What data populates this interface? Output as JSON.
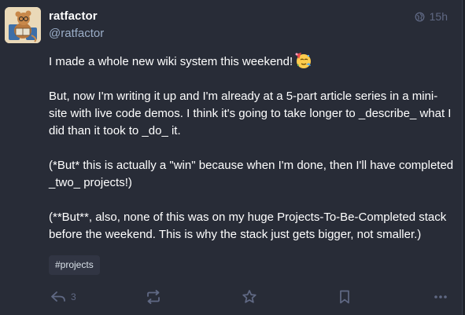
{
  "post": {
    "display_name": "ratfactor",
    "handle": "@ratfactor",
    "visibility_icon": "globe-icon",
    "timestamp": "15h",
    "paragraphs": {
      "p1": "I made a whole new wiki system this weekend!",
      "p2": "But, now I'm writing it up and I'm already at a 5-part article series in a mini-site with live code demos. I think it's going to take longer to _describe_ what I did than it took to _do_ it.",
      "p3": "(*But* this is actually a \"win\" because when I'm done, then I'll have completed _two_ projects!)",
      "p4": "(**But**, also, none of this was on my huge Projects-To-Be-Completed stack before the weekend. This is why the stack just gets bigger, not smaller.)"
    },
    "emoji": "partying-face-emoji",
    "hashtag": "#projects"
  },
  "actions": {
    "reply": {
      "icon": "reply-icon",
      "count": "3"
    },
    "boost": {
      "icon": "boost-icon"
    },
    "favourite": {
      "icon": "star-icon"
    },
    "bookmark": {
      "icon": "bookmark-icon"
    },
    "more": {
      "icon": "more-icon"
    }
  },
  "colors": {
    "background": "#282c37",
    "secondary_text": "#9baec8",
    "icon": "#606984",
    "tag_bg": "#313543"
  }
}
